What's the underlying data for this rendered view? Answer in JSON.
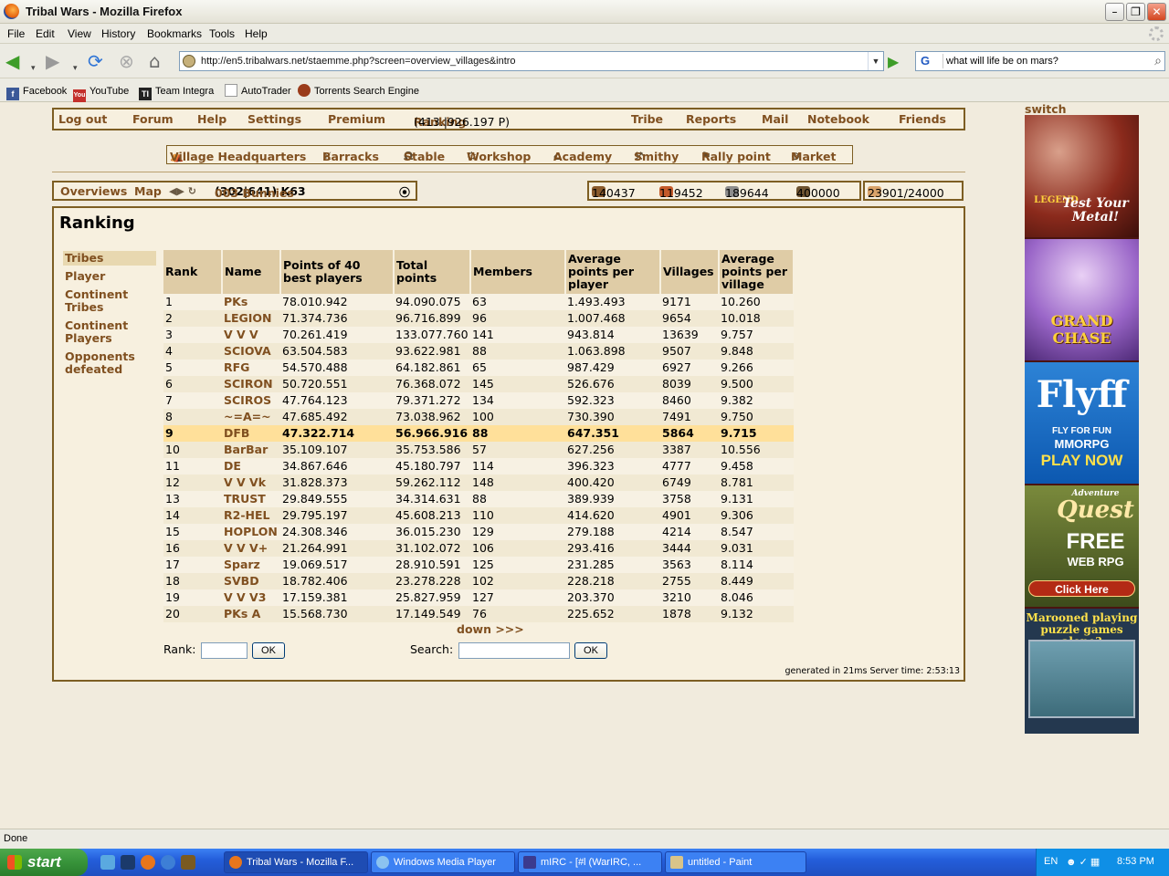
{
  "window": {
    "title": "Tribal Wars - Mozilla Firefox"
  },
  "menubar": [
    "File",
    "Edit",
    "View",
    "History",
    "Bookmarks",
    "Tools",
    "Help"
  ],
  "address": {
    "url": "http://en5.tribalwars.net/staemme.php?screen=overview_villages&intro"
  },
  "search": {
    "engine": "G",
    "query": "what will life be on mars?"
  },
  "bookmarks": [
    "Facebook",
    "YouTube",
    "Team Integra",
    "AutoTrader",
    "Torrents Search Engine"
  ],
  "game_menu": {
    "logout": "Log out",
    "forum": "Forum",
    "help": "Help",
    "settings": "Settings",
    "premium": "Premium",
    "ranking": "Ranking",
    "ranking_info": "(413.|926.197 P)",
    "tribe": "Tribe",
    "reports": "Reports",
    "mail": "Mail",
    "notebook": "Notebook",
    "friends": "Friends"
  },
  "buildings": [
    "Village Headquarters",
    "Barracks",
    "Stable",
    "Workshop",
    "Academy",
    "Smithy",
    "Rally point",
    "Market"
  ],
  "village_bar": {
    "overviews": "Overviews",
    "map": "Map",
    "village_name": "003 Bunnies",
    "coords": "(302|641) K63"
  },
  "resources": {
    "wood": "140437",
    "clay": "119452",
    "iron": "189644",
    "storage": "400000",
    "population": "23901/24000"
  },
  "ranking": {
    "heading": "Ranking",
    "side_nav": [
      "Tribes",
      "Player",
      "Continent Tribes",
      "Continent Players",
      "Opponents defeated"
    ],
    "columns": [
      "Rank",
      "Name",
      "Points of 40 best players",
      "Total points",
      "Members",
      "Average points per player",
      "Villages",
      "Average points per village"
    ],
    "rows": [
      [
        "1",
        "PKs",
        "78.010.942",
        "94.090.075",
        "63",
        "1.493.493",
        "9171",
        "10.260"
      ],
      [
        "2",
        "LEGION",
        "71.374.736",
        "96.716.899",
        "96",
        "1.007.468",
        "9654",
        "10.018"
      ],
      [
        "3",
        "V V V",
        "70.261.419",
        "133.077.760",
        "141",
        "943.814",
        "13639",
        "9.757"
      ],
      [
        "4",
        "SCIOVA",
        "63.504.583",
        "93.622.981",
        "88",
        "1.063.898",
        "9507",
        "9.848"
      ],
      [
        "5",
        "RFG",
        "54.570.488",
        "64.182.861",
        "65",
        "987.429",
        "6927",
        "9.266"
      ],
      [
        "6",
        "SCIRON",
        "50.720.551",
        "76.368.072",
        "145",
        "526.676",
        "8039",
        "9.500"
      ],
      [
        "7",
        "SCIROS",
        "47.764.123",
        "79.371.272",
        "134",
        "592.323",
        "8460",
        "9.382"
      ],
      [
        "8",
        "~=A=~",
        "47.685.492",
        "73.038.962",
        "100",
        "730.390",
        "7491",
        "9.750"
      ],
      [
        "9",
        "DFB",
        "47.322.714",
        "56.966.916",
        "88",
        "647.351",
        "5864",
        "9.715"
      ],
      [
        "10",
        "BarBar",
        "35.109.107",
        "35.753.586",
        "57",
        "627.256",
        "3387",
        "10.556"
      ],
      [
        "11",
        "DE",
        "34.867.646",
        "45.180.797",
        "114",
        "396.323",
        "4777",
        "9.458"
      ],
      [
        "12",
        "V V Vk",
        "31.828.373",
        "59.262.112",
        "148",
        "400.420",
        "6749",
        "8.781"
      ],
      [
        "13",
        "TRUST",
        "29.849.555",
        "34.314.631",
        "88",
        "389.939",
        "3758",
        "9.131"
      ],
      [
        "14",
        "R2-HEL",
        "29.795.197",
        "45.608.213",
        "110",
        "414.620",
        "4901",
        "9.306"
      ],
      [
        "15",
        "HOPLON",
        "24.308.346",
        "36.015.230",
        "129",
        "279.188",
        "4214",
        "8.547"
      ],
      [
        "16",
        "V V V+",
        "21.264.991",
        "31.102.072",
        "106",
        "293.416",
        "3444",
        "9.031"
      ],
      [
        "17",
        "Sparz",
        "19.069.517",
        "28.910.591",
        "125",
        "231.285",
        "3563",
        "8.114"
      ],
      [
        "18",
        "SVBD",
        "18.782.406",
        "23.278.228",
        "102",
        "228.218",
        "2755",
        "8.449"
      ],
      [
        "19",
        "V V V3",
        "17.159.381",
        "25.827.959",
        "127",
        "203.370",
        "3210",
        "8.046"
      ],
      [
        "20",
        "PKs A",
        "15.568.730",
        "17.149.549",
        "76",
        "225.652",
        "1878",
        "9.132"
      ]
    ],
    "highlight_rank": "9",
    "down_link": "down >>>",
    "rank_label": "Rank:",
    "search_label": "Search:",
    "ok_label": "OK",
    "generated": "generated in 21ms Server time: 2:53:13"
  },
  "ads": {
    "switch": "switch",
    "ad1": [
      "LEGEND",
      "Test Your Metal!"
    ],
    "ad2": "GRAND CHASE",
    "ad3": [
      "Flyff",
      "FLY FOR FUN",
      "MMORPG",
      "PLAY NOW"
    ],
    "ad4": [
      "Adventure",
      "Quest",
      "FREE",
      "WEB RPG",
      "Click Here"
    ],
    "ad5": "Marooned playing puzzle games alone?"
  },
  "statusbar": {
    "text": "Done"
  },
  "taskbar": {
    "start": "start",
    "tasks": [
      "Tribal Wars - Mozilla F...",
      "Windows Media Player",
      "mIRC - [#l (WarIRC, ...",
      "untitled - Paint"
    ],
    "lang": "EN",
    "clock": "8:53 PM"
  }
}
